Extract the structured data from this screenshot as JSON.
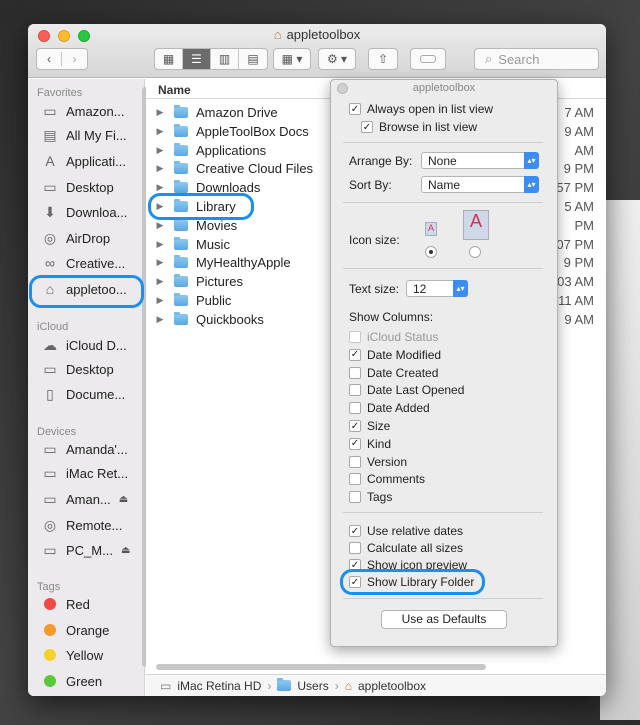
{
  "window": {
    "title": "appletoolbox",
    "search_placeholder": "Search"
  },
  "sidebar": {
    "favorites_label": "Favorites",
    "favorites": [
      {
        "label": "Amazon..."
      },
      {
        "label": "All My Fi..."
      },
      {
        "label": "Applicati..."
      },
      {
        "label": "Desktop"
      },
      {
        "label": "Downloa..."
      },
      {
        "label": "AirDrop"
      },
      {
        "label": "Creative..."
      },
      {
        "label": "appletoo..."
      }
    ],
    "icloud_label": "iCloud",
    "icloud": [
      {
        "label": "iCloud D..."
      },
      {
        "label": "Desktop"
      },
      {
        "label": "Docume..."
      }
    ],
    "devices_label": "Devices",
    "devices": [
      {
        "label": "Amanda'..."
      },
      {
        "label": "iMac Ret..."
      },
      {
        "label": "Aman..."
      },
      {
        "label": "Remote..."
      },
      {
        "label": "PC_M..."
      }
    ],
    "tags_label": "Tags",
    "tags": [
      {
        "label": "Red",
        "color": "#ee4a46"
      },
      {
        "label": "Orange",
        "color": "#f39a2c"
      },
      {
        "label": "Yellow",
        "color": "#f5d22a"
      },
      {
        "label": "Green",
        "color": "#5cc63d"
      }
    ]
  },
  "list": {
    "name_header": "Name",
    "rows": [
      {
        "name": "Amazon Drive",
        "date": "7 AM"
      },
      {
        "name": "AppleToolBox Docs",
        "date": "9 AM"
      },
      {
        "name": "Applications",
        "date": "AM"
      },
      {
        "name": "Creative Cloud Files",
        "date": "9 PM"
      },
      {
        "name": "Downloads",
        "date": "57 PM"
      },
      {
        "name": "Library",
        "date": "5 AM"
      },
      {
        "name": "Movies",
        "date": "PM"
      },
      {
        "name": "Music",
        "date": "07 PM"
      },
      {
        "name": "MyHealthyApple",
        "date": "9 PM"
      },
      {
        "name": "Pictures",
        "date": "03 AM"
      },
      {
        "name": "Public",
        "date": "11 AM"
      },
      {
        "name": "Quickbooks",
        "date": "9 AM"
      }
    ]
  },
  "pathbar": {
    "items": [
      "iMac Retina HD",
      "Users",
      "appletoolbox"
    ]
  },
  "panel": {
    "title": "appletoolbox",
    "always_open": "Always open in list view",
    "browse": "Browse in list view",
    "arrange_label": "Arrange By:",
    "arrange_value": "None",
    "sort_label": "Sort By:",
    "sort_value": "Name",
    "icon_size_label": "Icon size:",
    "text_size_label": "Text size:",
    "text_size_value": "12",
    "show_columns_label": "Show Columns:",
    "columns": [
      {
        "label": "iCloud Status",
        "checked": false,
        "disabled": true
      },
      {
        "label": "Date Modified",
        "checked": true
      },
      {
        "label": "Date Created",
        "checked": false
      },
      {
        "label": "Date Last Opened",
        "checked": false
      },
      {
        "label": "Date Added",
        "checked": false
      },
      {
        "label": "Size",
        "checked": true
      },
      {
        "label": "Kind",
        "checked": true
      },
      {
        "label": "Version",
        "checked": false
      },
      {
        "label": "Comments",
        "checked": false
      },
      {
        "label": "Tags",
        "checked": false
      }
    ],
    "options": [
      {
        "label": "Use relative dates",
        "checked": true
      },
      {
        "label": "Calculate all sizes",
        "checked": false
      },
      {
        "label": "Show icon preview",
        "checked": true
      },
      {
        "label": "Show Library Folder",
        "checked": true
      }
    ],
    "defaults_button": "Use as Defaults"
  },
  "colors": {
    "highlight_ring": "#1a8ff2",
    "select_accent": "#3b8ef0"
  }
}
